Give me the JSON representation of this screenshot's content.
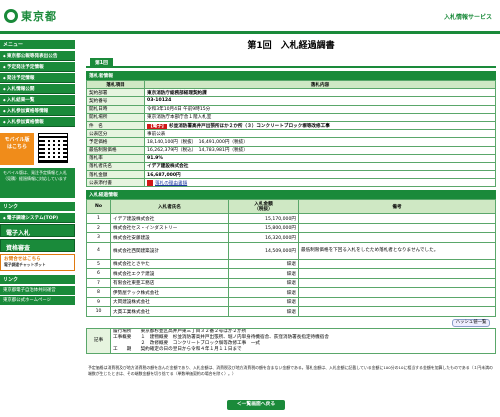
{
  "header": {
    "logo_text": "東京都",
    "service_title": "入札情報サービス"
  },
  "sidebar": {
    "menu_caption": "メニュー",
    "items": [
      "東京都公報等発表出公告",
      "予定発注予定情報",
      "発注予定情報",
      "入札情報公開",
      "入札結果一覧",
      "入札参加資格等情報",
      "入札参加資格情報"
    ],
    "mobile_label": "モバイル版",
    "mobile_sub": "はこちら",
    "mobile_note": "モバイル版は、発注予定情報と入札（見積）経過情報に対応しています",
    "links_caption": "リンク",
    "link_items": [
      "電子調達システム(TOP)"
    ],
    "big_buttons": [
      "電子入札",
      "資格審査"
    ],
    "qa_title": "お問合せはこちら",
    "qa_sub": "電子調達チャットボット",
    "footer_links_caption": "リンク",
    "footer_links": [
      "東京都電子自治体共同運営",
      "東京都公式ホームページ"
    ]
  },
  "main": {
    "page_title": "第1回　入札経過調書",
    "tab_label": "第1回",
    "section1": "落札者情報",
    "info_header": [
      "落札項目",
      "落札内容"
    ],
    "info_rows": [
      {
        "k": "契約部署",
        "v": "東京消防庁総務部経理契約課"
      },
      {
        "k": "契約番号",
        "v": "03-10124"
      },
      {
        "k": "開札日時",
        "v": "令和3年10月4日 午前9時15分"
      },
      {
        "k": "開札場所",
        "v": "東京消防庁本部庁舎１階入札室"
      },
      {
        "k": "件　名",
        "tag": "【電子】",
        "v": "杉並消防署高井戸出張所ほか２か所（３）コンクリートブロック塀等改修工事"
      },
      {
        "k": "公表区分",
        "v": "事前公表"
      },
      {
        "k": "予定価格",
        "v": "18,140,100円（税抜）　16,491,000円（税抜）"
      },
      {
        "k": "最低制限価格",
        "v": "16,262,379円（税込）　14,783,981円（税抜）"
      },
      {
        "k": "落札率",
        "v": "91.9%"
      },
      {
        "k": "落札者氏名",
        "v": "イデア建設株式会社"
      },
      {
        "k": "落札金額",
        "v": "16,687,000円"
      },
      {
        "k": "公表添付書",
        "v": "落札の理由書類"
      }
    ],
    "section2": "入札経過情報",
    "bid_header": [
      "No",
      "入札者氏名",
      "入札金額\n（税抜）",
      "備考"
    ],
    "bids": [
      {
        "no": "1",
        "name": "イデア建設株式会社",
        "amount": "15,170,000円",
        "note": ""
      },
      {
        "no": "2",
        "name": "株式会社セス・インダストリー",
        "amount": "15,800,000円",
        "note": ""
      },
      {
        "no": "3",
        "name": "株式会社安藤建設",
        "amount": "16,320,000円",
        "note": ""
      },
      {
        "no": "4",
        "name": "株式会社西関建築設計",
        "amount": "14,509,000円",
        "note": "最低制限価格を下回る入札をしたため落札者となりませんでした。"
      },
      {
        "no": "5",
        "name": "株式会社とさやた",
        "amount": "辞退",
        "note": ""
      },
      {
        "no": "6",
        "name": "株式会社エクテ建設",
        "amount": "辞退",
        "note": ""
      },
      {
        "no": "7",
        "name": "有限会社東亜工務店",
        "amount": "辞退",
        "note": ""
      },
      {
        "no": "8",
        "name": "伊勢屋テック株式会社",
        "amount": "辞退",
        "note": ""
      },
      {
        "no": "9",
        "name": "大岡建設株式会社",
        "amount": "辞退",
        "note": ""
      },
      {
        "no": "10",
        "name": "大貫工業株式会社",
        "amount": "辞退",
        "note": ""
      }
    ],
    "history_button": "ハッシュ値一覧",
    "memo_label": "記事",
    "memo_lines": [
      "履行場所　　東京都杉並区高井戸東三丁目３２番２号ほか２か所",
      "工事概要　　１　建物概要　杉並消防署高井戸出張所、堀ノ内単身待機宿舎、荻窪消防署長指定待機宿舎",
      "　　　　　　２　改修概要　コンクリートブロック塀等改修工事　一式",
      "工　　期　　契約確定の日の翌日から令和４年１月１１日まで"
    ],
    "notes": "予定価格は消費税及び地方消費税の額を含んだ金額であり、入札金額は、消費税及び地方消費税の額を含まない金額である。落札金額は、入札金額に記載している金額に100分の10に相当する金額を加算したものである（１円未満の端数が生じたときは、その端数金額を切り捨てる（単数単価契約の場合を除く）。）",
    "back_button": "＜一覧画面へ戻る"
  },
  "colors": {
    "brand_green": "#1a8a3a",
    "accent_orange": "#f08c1a",
    "alert_red": "#d01818"
  }
}
